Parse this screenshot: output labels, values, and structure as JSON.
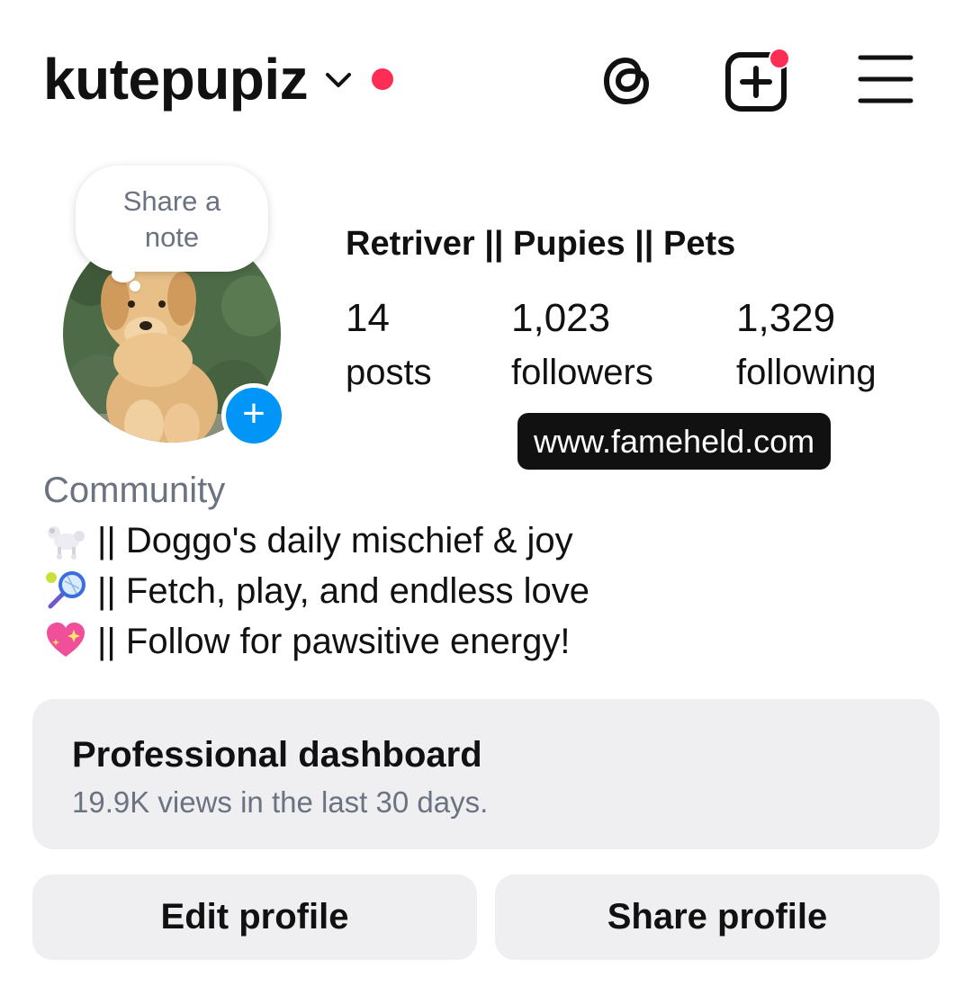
{
  "header": {
    "username": "kutepupiz"
  },
  "note": {
    "line1": "Share a",
    "line2": "note"
  },
  "profile": {
    "display_name": "Retriver || Pupies || Pets",
    "stats": [
      {
        "value": "14",
        "label": "posts"
      },
      {
        "value": "1,023",
        "label": "followers"
      },
      {
        "value": "1,329",
        "label": "following"
      }
    ],
    "link": "www.fameheld.com",
    "category": "Community",
    "bio": [
      {
        "icon": "poodle-emoji",
        "text": "|| Doggo's daily mischief & joy"
      },
      {
        "icon": "tennis-emoji",
        "text": "|| Fetch, play, and endless love"
      },
      {
        "icon": "sparkling-heart-emoji",
        "text": "|| Follow for pawsitive energy!"
      }
    ]
  },
  "dashboard": {
    "title": "Professional dashboard",
    "subtitle": "19.9K views in the last 30 days."
  },
  "buttons": {
    "edit": "Edit profile",
    "share": "Share profile"
  },
  "colors": {
    "accent_blue": "#0095f6",
    "notification_red": "#ff2d55",
    "card_bg": "#efeff2"
  }
}
